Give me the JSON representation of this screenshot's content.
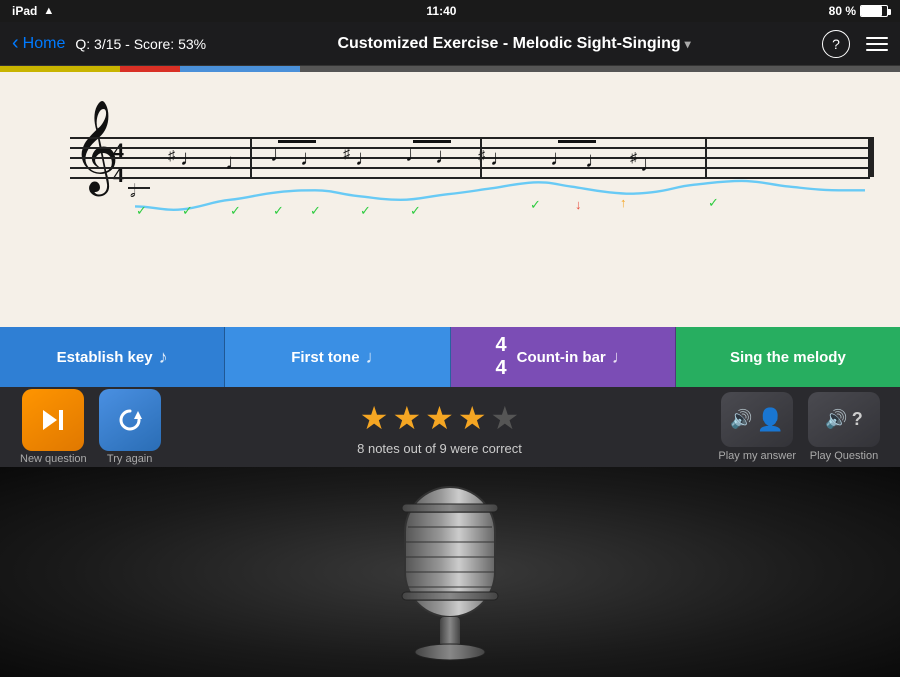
{
  "status_bar": {
    "carrier": "iPad",
    "time": "11:40",
    "battery": "80 %"
  },
  "nav": {
    "back_label": "Home",
    "score_label": "Q: 3/15 - Score: 53%",
    "title": "Customized Exercise - Melodic Sight-Singing",
    "help_label": "?",
    "chevron": "▾"
  },
  "steps": {
    "establish_key": "Establish key",
    "first_tone": "First tone",
    "count_in": "Count-in bar",
    "time_sig": "4/4",
    "sing_melody": "Sing the melody"
  },
  "controls": {
    "new_question_label": "New question",
    "try_again_label": "Try again",
    "play_my_answer_label": "Play my answer",
    "play_question_label": "Play Question"
  },
  "result": {
    "stars_filled": 4,
    "stars_empty": 1,
    "notes_text": "8 notes out of 9 were correct"
  }
}
